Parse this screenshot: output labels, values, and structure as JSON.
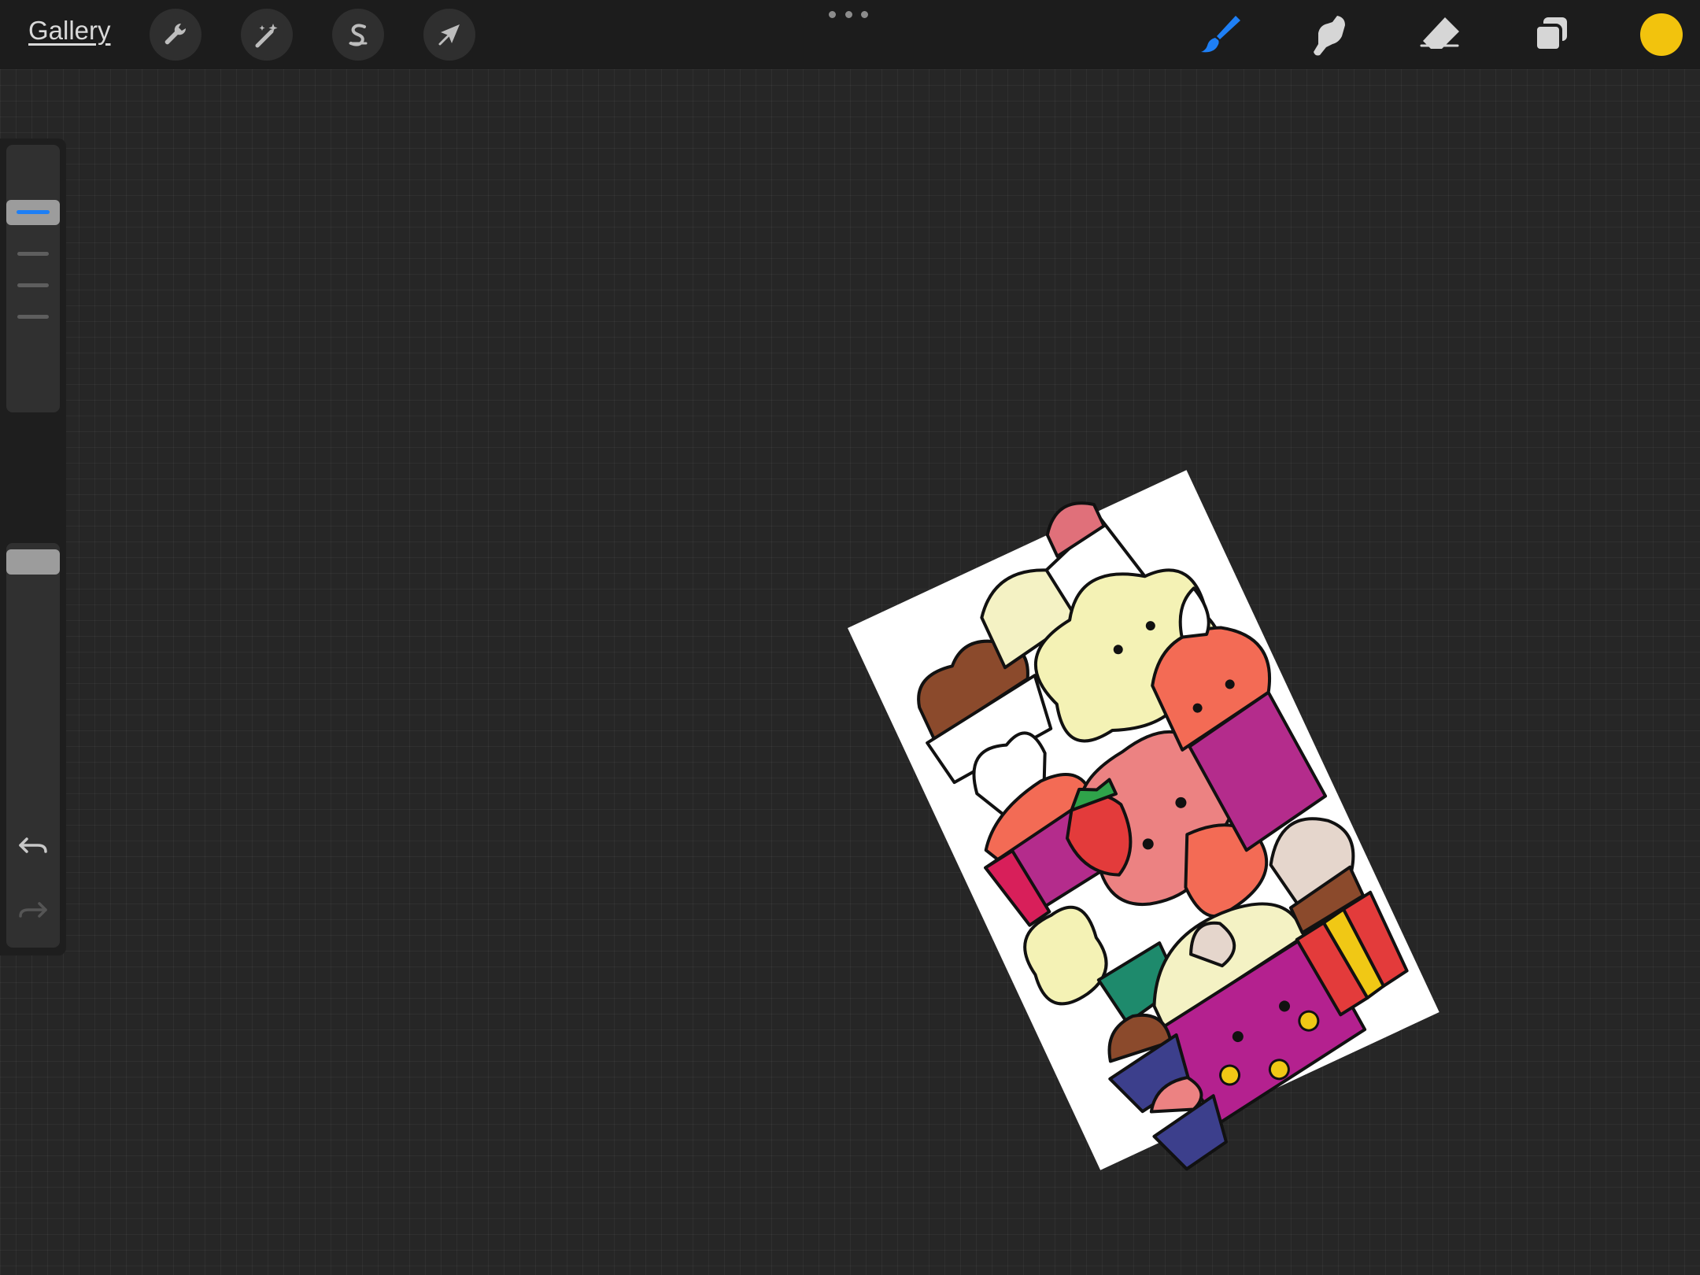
{
  "app": {
    "gallery_label": "Gallery"
  },
  "toolbar_left": [
    {
      "name": "actions-wrench"
    },
    {
      "name": "adjustments-magic-wand"
    },
    {
      "name": "selection-s"
    },
    {
      "name": "transform-arrow"
    }
  ],
  "toolbar_right": [
    {
      "name": "brush",
      "active": true
    },
    {
      "name": "smudge",
      "active": false
    },
    {
      "name": "eraser",
      "active": false
    },
    {
      "name": "layers",
      "active": false
    }
  ],
  "colors": {
    "current_color": "#f2c30d",
    "accent": "#1e7ff5",
    "canvas": "#262626"
  },
  "sidebar": {
    "brush_size_level": 0.16,
    "opacity_level": 0.04,
    "undo": "undo-icon",
    "redo": "redo-icon"
  }
}
